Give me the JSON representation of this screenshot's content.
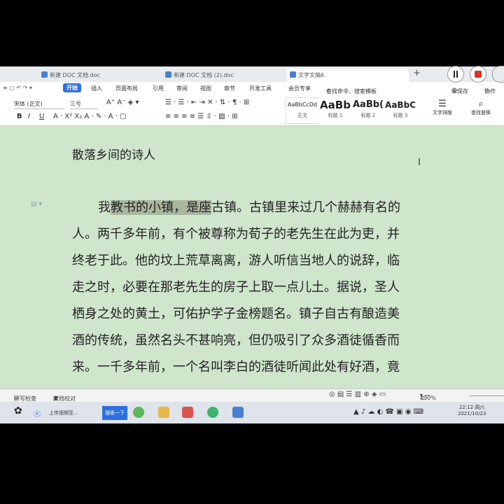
{
  "tabs": [
    {
      "label": "新建 DOC 文档.doc"
    },
    {
      "label": "新建 DOC 文档 (2).doc"
    },
    {
      "label": "文字文稿6"
    }
  ],
  "menu": {
    "start": "开始",
    "items": [
      "插入",
      "页面布局",
      "引用",
      "审阅",
      "视图",
      "章节",
      "开发工具",
      "会员专享"
    ],
    "search": "查找命令、搜索模板",
    "unsaved": "未保存",
    "collab": "协作"
  },
  "ribbon": {
    "font": "宋体 (正文)",
    "size": "三号",
    "styles": [
      {
        "preview": "AaBbCcDd",
        "label": "正文"
      },
      {
        "preview": "AaBb",
        "label": "标题 1"
      },
      {
        "preview": "AaBb(",
        "label": "标题 2"
      },
      {
        "preview": "AaBbC",
        "label": "标题 3"
      }
    ],
    "text_layout": "文字排版",
    "find_replace": "查找替换"
  },
  "document": {
    "title": "散落乡间的诗人",
    "lines": [
      {
        "pre": "我",
        "hl": "教书的小镇，是座",
        "post": "古镇。古镇里来过几个赫赫有名的"
      },
      {
        "text": "人。两千多年前，有个被尊称为荀子的老先生在此为吏，并"
      },
      {
        "text": "终老于此。他的坟上荒草离离，游人听信当地人的说辞，临"
      },
      {
        "text": "走之时，必要在那老先生的房子上取一点儿土。据说，圣人"
      },
      {
        "text": "栖身之处的黄土，可佑护学子金榜题名。镇子自古有酿造美"
      },
      {
        "text": "酒的传统，虽然名头不甚响亮，但仍吸引了众多酒徒循香而"
      },
      {
        "text": "来。一千多年前，一个名叫李白的酒徒听闻此处有好酒，竟"
      }
    ]
  },
  "statusbar": {
    "spell": "拼写检查",
    "proof": "文档校对",
    "zoom": "130%"
  },
  "taskbar": {
    "browser_label": "上传视频至...",
    "active_label": "搜索一下",
    "time": "22:12 周六",
    "date": "2021/10/23"
  }
}
